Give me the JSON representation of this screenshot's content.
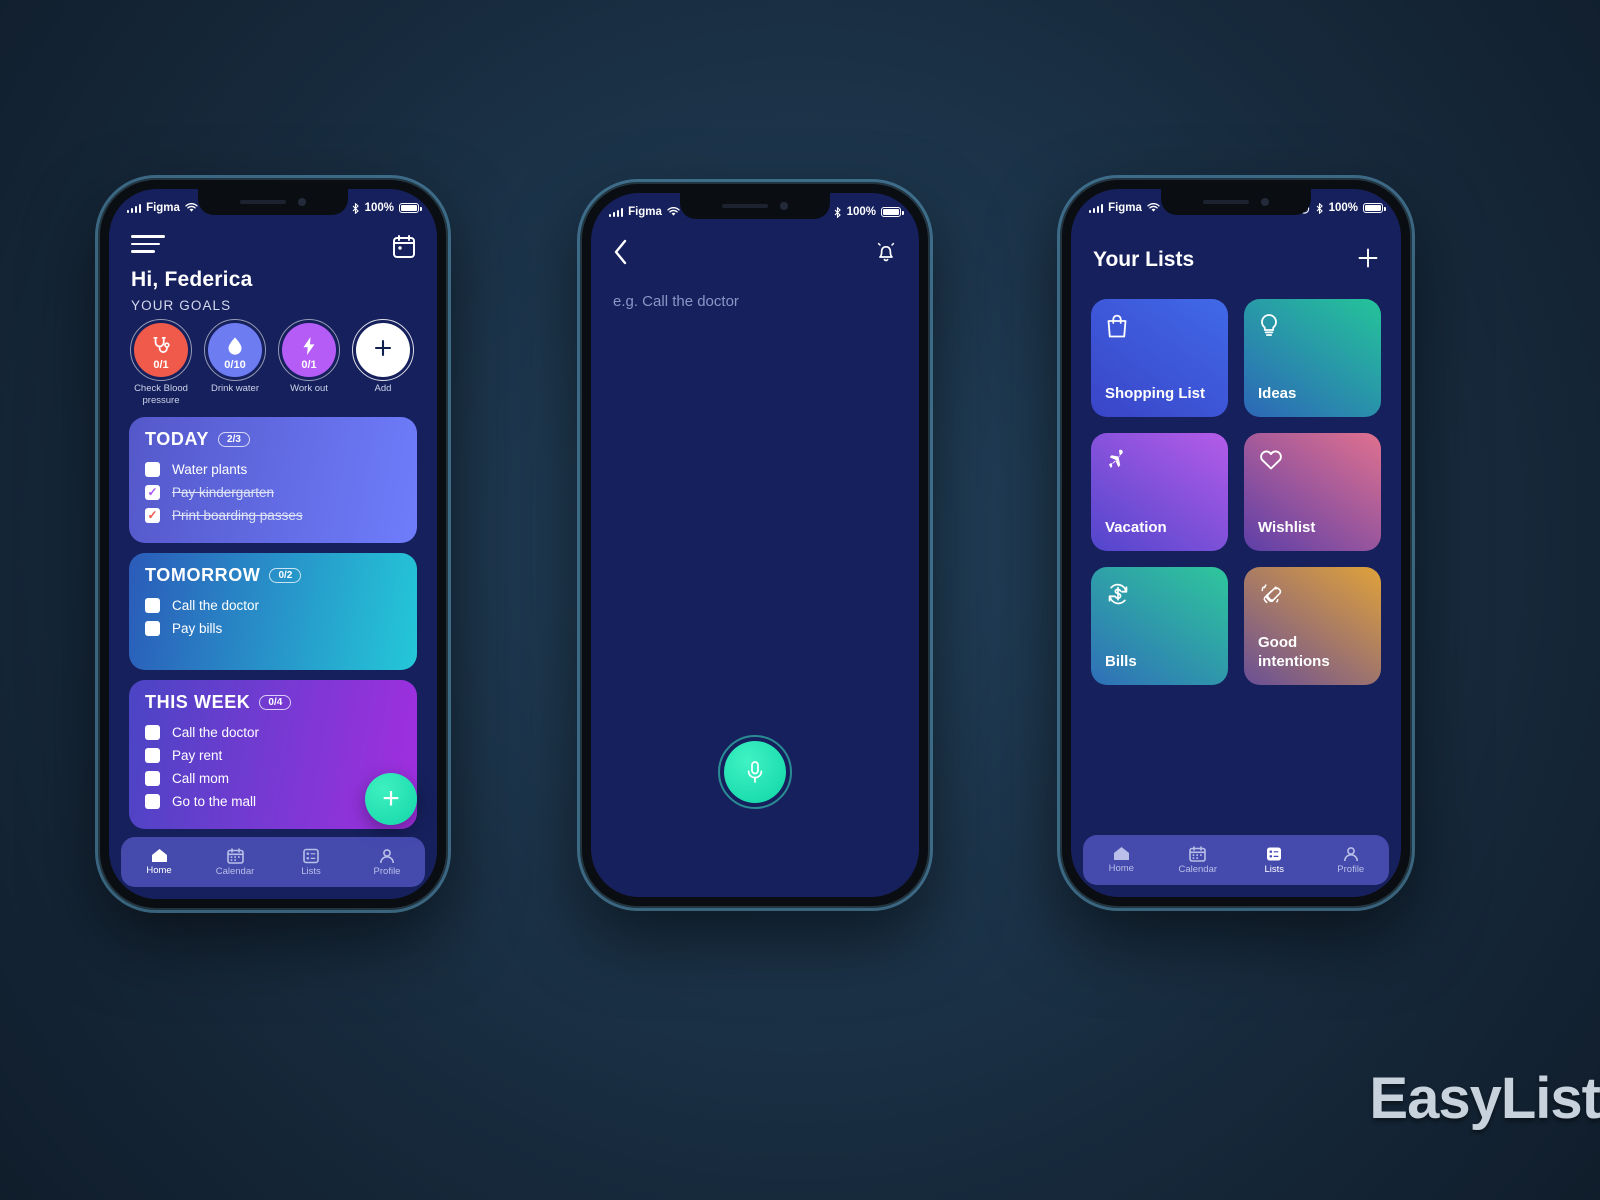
{
  "background": {
    "color": "#1c344a"
  },
  "logo": {
    "text": "EasyList"
  },
  "status_bar": {
    "carrier": "Figma",
    "battery_percent": "100%"
  },
  "phone1": {
    "greeting": "Hi, Federica",
    "goals_label": "YOUR GOALS",
    "menu_icon": "hamburger-icon",
    "calendar_icon": "calendar-icon",
    "goals": [
      {
        "name": "Check Blood pressure",
        "count": "0/1",
        "icon": "stethoscope-icon",
        "color": "#f05a4b"
      },
      {
        "name": "Drink water",
        "count": "0/10",
        "icon": "water-drop-icon",
        "color": "#6d7cf0"
      },
      {
        "name": "Work out",
        "count": "0/1",
        "icon": "lightning-bolt-icon",
        "color": "#b45cf5"
      },
      {
        "name": "Add",
        "count": "",
        "icon": "plus-icon",
        "color": "#ffffff"
      }
    ],
    "cards": [
      {
        "title": "TODAY",
        "badge": "2/3",
        "gradient_from": "#5458c9",
        "gradient_to": "#6f7dfb",
        "tasks": [
          {
            "label": "Water plants",
            "done": false,
            "check_color": ""
          },
          {
            "label": "Pay kindergarten",
            "done": true,
            "check_color": "purple"
          },
          {
            "label": "Print boarding passes",
            "done": true,
            "check_color": "red"
          }
        ]
      },
      {
        "title": "TOMORROW",
        "badge": "0/2",
        "gradient_from": "#2b5bb9",
        "gradient_to": "#24c8d8",
        "tasks": [
          {
            "label": "Call the doctor",
            "done": false,
            "check_color": ""
          },
          {
            "label": "Pay bills",
            "done": false,
            "check_color": ""
          }
        ]
      },
      {
        "title": "THIS WEEK",
        "badge": "0/4",
        "gradient_from": "#4a45c4",
        "gradient_to": "#a22ee0",
        "tasks": [
          {
            "label": "Call the doctor",
            "done": false,
            "check_color": ""
          },
          {
            "label": "Pay rent",
            "done": false,
            "check_color": ""
          },
          {
            "label": "Call mom",
            "done": false,
            "check_color": ""
          },
          {
            "label": "Go to the mall",
            "done": false,
            "check_color": ""
          }
        ]
      }
    ],
    "add_button": {
      "icon": "plus-icon",
      "color": "#12d6a8"
    },
    "tabs": [
      {
        "label": "Home",
        "icon": "home-icon",
        "active": true
      },
      {
        "label": "Calendar",
        "icon": "calendar-icon",
        "active": false
      },
      {
        "label": "Lists",
        "icon": "lists-icon",
        "active": false
      },
      {
        "label": "Profile",
        "icon": "person-icon",
        "active": false
      }
    ]
  },
  "phone2": {
    "back_icon": "chevron-left-icon",
    "bell_icon": "bell-icon",
    "placeholder": "e.g. Call the doctor",
    "mic_button": {
      "icon": "microphone-icon",
      "color": "#12d6a8"
    }
  },
  "phone3": {
    "title": "Your Lists",
    "add_icon": "plus-icon",
    "tiles": [
      {
        "name": "Shopping List",
        "icon": "shopping-bag-icon",
        "gradient_from": "#3f4fd0",
        "gradient_to": "#3f6ae6"
      },
      {
        "name": "Ideas",
        "icon": "lightbulb-icon",
        "gradient_from": "#2d67b8",
        "gradient_to": "#24c49a"
      },
      {
        "name": "Vacation",
        "icon": "airplane-icon",
        "gradient_from": "#5b4bd0",
        "gradient_to": "#b55ce8"
      },
      {
        "name": "Wishlist",
        "icon": "heart-icon",
        "gradient_from": "#5d3fa8",
        "gradient_to": "#e0718f"
      },
      {
        "name": "Bills",
        "icon": "dollar-refresh-icon",
        "gradient_from": "#2f6fb8",
        "gradient_to": "#2fc79c"
      },
      {
        "name": "Good intentions",
        "icon": "praying-hands-icon",
        "gradient_from": "#6a4f96",
        "gradient_to": "#e0a23a"
      }
    ],
    "tabs": [
      {
        "label": "Home",
        "icon": "home-icon",
        "active": false
      },
      {
        "label": "Calendar",
        "icon": "calendar-icon",
        "active": false
      },
      {
        "label": "Lists",
        "icon": "lists-icon",
        "active": true
      },
      {
        "label": "Profile",
        "icon": "person-icon",
        "active": false
      }
    ]
  }
}
